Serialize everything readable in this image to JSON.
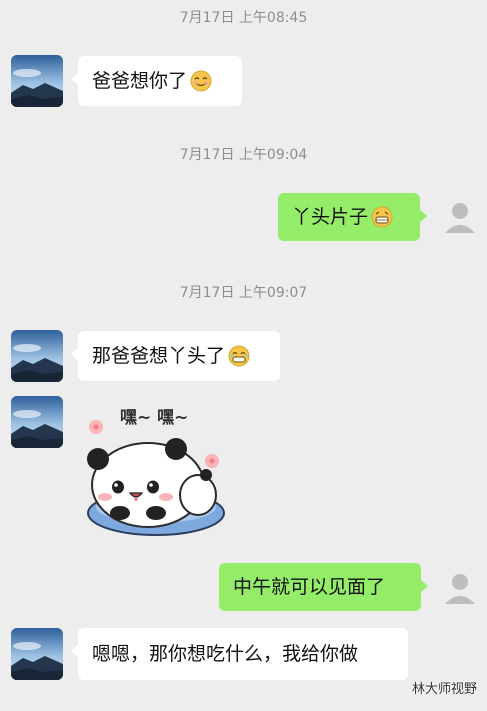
{
  "chat": {
    "timestamps": [
      "7月17日 上午08:45",
      "7月17日 上午09:04",
      "7月17日 上午09:07"
    ],
    "messages": [
      {
        "side": "left",
        "text": "爸爸想你了"
      },
      {
        "side": "right",
        "text": "丫头片子"
      },
      {
        "side": "left",
        "text": "那爸爸想丫头了"
      },
      {
        "side": "left",
        "sticker_text": "嘿~ 嘿~"
      },
      {
        "side": "right",
        "text": "中午就可以见面了"
      },
      {
        "side": "left",
        "text": "嗯嗯，那你想吃什么，我给你做"
      }
    ]
  },
  "watermark": "林大师视野",
  "icons": {
    "emoji_1": "shy-smile-emoji",
    "emoji_2": "grin-emoji",
    "emoji_3": "grimace-emoji",
    "other_avatar": "mountain-landscape",
    "self_avatar": "default-user-silhouette"
  }
}
